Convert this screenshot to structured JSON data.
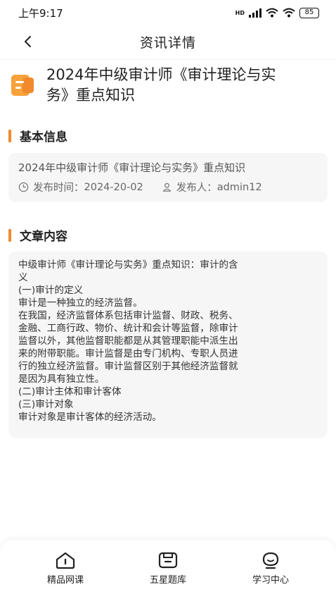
{
  "status_bar": {
    "time": "上午9:17",
    "battery": "85",
    "network": "HD"
  },
  "nav": {
    "title": "资讯详情"
  },
  "article": {
    "title_line1": "2024年中级审计师《审计理论与实",
    "title_line2": "务》重点知识"
  },
  "basic_info": {
    "section_title": "基本信息",
    "title": "2024年中级审计师《审计理论与实务》重点知识",
    "publish_time_label": "发布时间：",
    "publish_time": "2024-20-02",
    "publisher_label": "发布人：",
    "publisher": "admin12"
  },
  "content": {
    "section_title": "文章内容",
    "lines": [
      "中级审计师《审计理论与实务》重点知识：审计的含",
      "义",
      "(一)审计的定义",
      "审计是一种独立的经济监督。",
      "在我国，经济监督体系包括审计监督、财政、税务、",
      "金融、工商行政、物价、统计和会计等监督，除审计",
      "监督以外，其他监督职能都是从其管理职能中派生出",
      "来的附带职能。审计监督是由专门机构、专职人员进",
      "行的独立经济监督。审计监督区别于其他经济监督就",
      "是因为具有独立性。",
      "(二)审计主体和审计客体",
      "(三)审计对象",
      "审计对象是审计客体的经济活动。"
    ]
  },
  "tabs": [
    {
      "label": "精品网课"
    },
    {
      "label": "五星题库"
    },
    {
      "label": "学习中心"
    }
  ],
  "colors": {
    "accent": "#f08a2c",
    "card_bg": "#f6f6f6"
  }
}
